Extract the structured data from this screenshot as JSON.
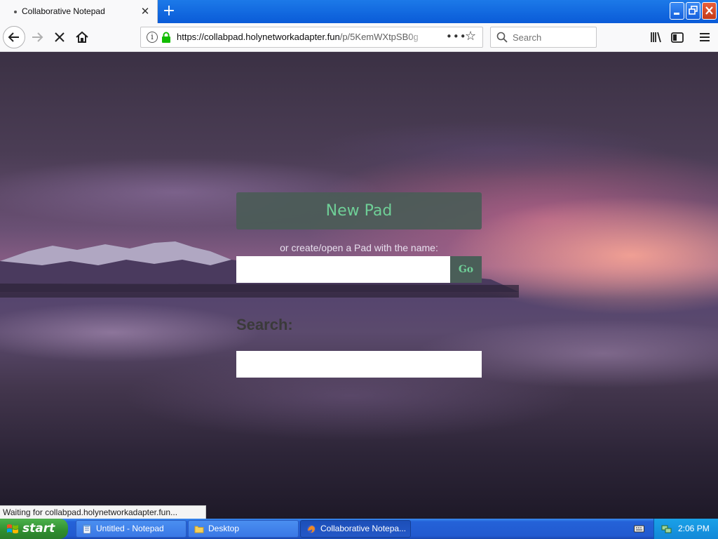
{
  "browser": {
    "tab_title": "Collaborative Notepad",
    "url_host": "https://collabpad.holynetworkadapter.fun",
    "url_path": "/p/5KemWXtpSB0g",
    "search_placeholder": "Search",
    "status_text": "Waiting for collabpad.holynetworkadapter.fun..."
  },
  "page": {
    "new_pad_label": "New Pad",
    "create_label": "or create/open a Pad with the name:",
    "go_label": "Go",
    "search_heading": "Search:"
  },
  "taskbar": {
    "start_label": "start",
    "tasks": [
      {
        "label": "Untitled - Notepad"
      },
      {
        "label": "Desktop"
      },
      {
        "label": "Collaborative Notepa..."
      }
    ],
    "clock": "2:06 PM"
  },
  "colors": {
    "accent_green": "#6fcf97",
    "xp_blue": "#225ad0",
    "start_green": "#2f8e2f"
  }
}
